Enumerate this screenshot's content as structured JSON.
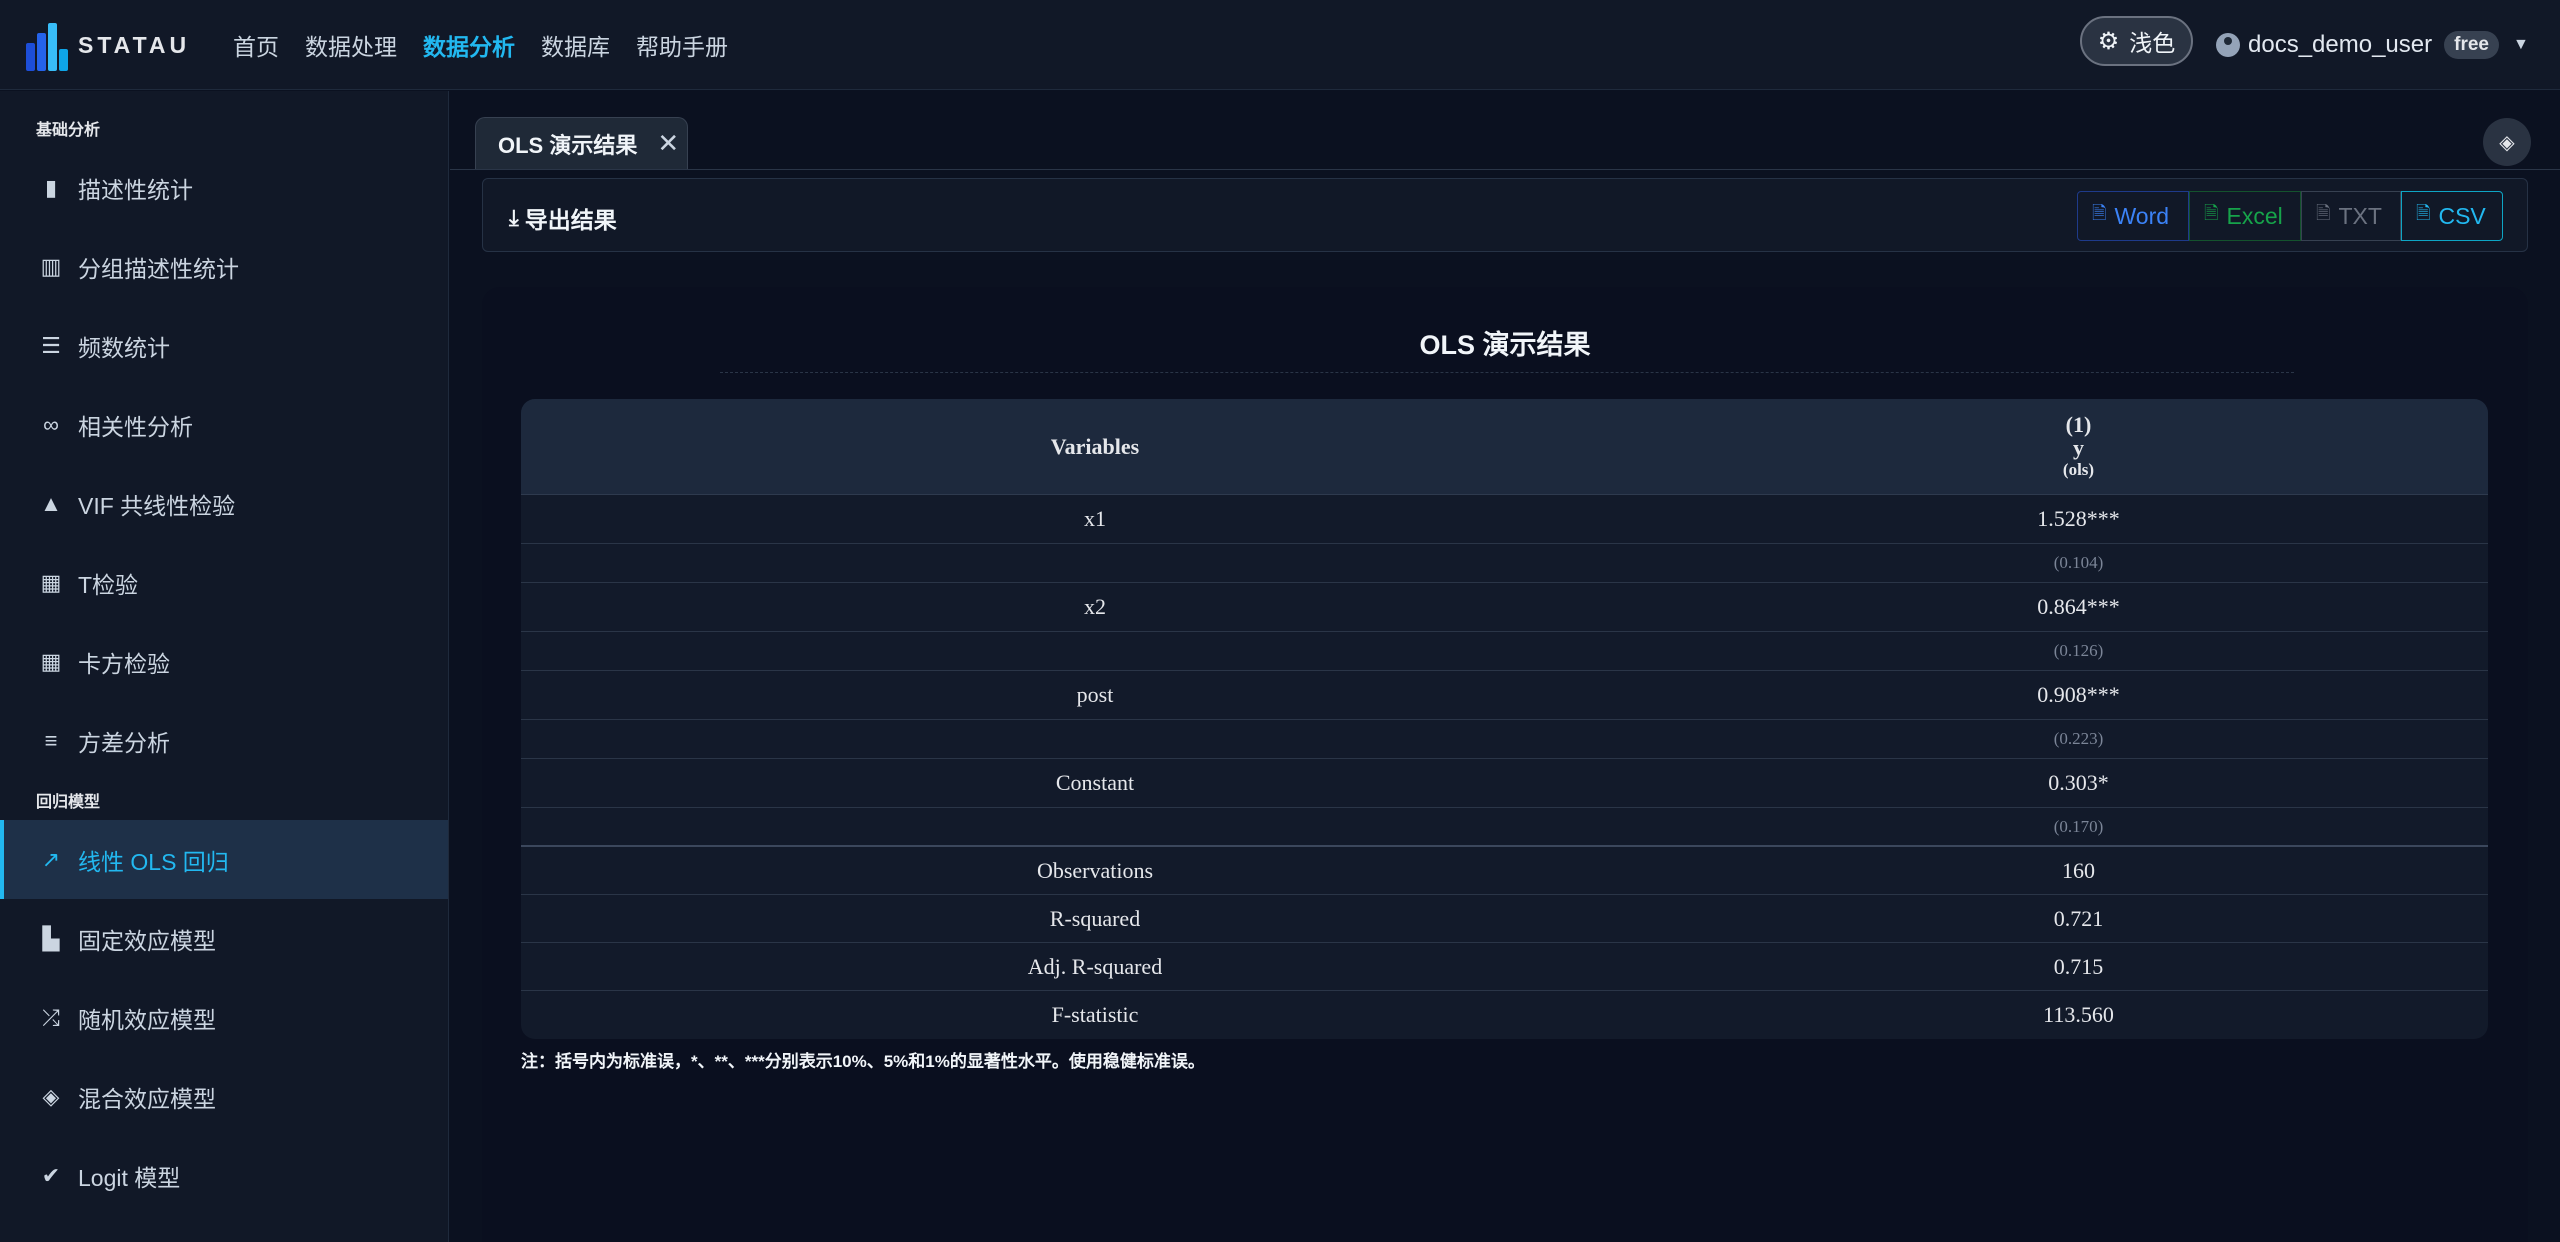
{
  "app": {
    "brand": "STATAU",
    "nav": [
      "首页",
      "数据处理",
      "数据分析",
      "数据库",
      "帮助手册"
    ],
    "active_nav": "数据分析",
    "theme_toggle_label": "浅色",
    "user": {
      "name": "docs_demo_user",
      "plan": "free"
    },
    "accent_color": "#22b8f0"
  },
  "sidebar": {
    "group_basic": "基础分析",
    "basic_items": [
      {
        "label": "描述性统计",
        "icon": "bar-chart-icon"
      },
      {
        "label": "分组描述性统计",
        "icon": "grouped-bar-chart-icon"
      },
      {
        "label": "频数统计",
        "icon": "table-list-icon"
      },
      {
        "label": "相关性分析",
        "icon": "link-icon"
      },
      {
        "label": "VIF 共线性检验",
        "icon": "warning-icon"
      },
      {
        "label": "T检验",
        "icon": "calculator-icon"
      },
      {
        "label": "卡方检验",
        "icon": "grid-icon"
      },
      {
        "label": "方差分析",
        "icon": "bar-chart-horizontal-icon"
      }
    ],
    "group_regression": "回归模型",
    "regression_items": [
      {
        "label": "线性 OLS 回归",
        "icon": "line-chart-icon",
        "active": true
      },
      {
        "label": "固定效应模型",
        "icon": "building-icon"
      },
      {
        "label": "随机效应模型",
        "icon": "shuffle-icon"
      },
      {
        "label": "混合效应模型",
        "icon": "layers-icon"
      },
      {
        "label": "Logit 模型",
        "icon": "check-circle-icon"
      }
    ]
  },
  "main": {
    "tab_label": "OLS 演示结果",
    "export": {
      "title": "导出结果",
      "buttons": [
        "Word",
        "Excel",
        "TXT",
        "CSV"
      ]
    },
    "result_title": "OLS 演示结果",
    "table": {
      "header": {
        "variables": "Variables",
        "model_num": "(1)",
        "dep_var": "y",
        "method": "(ols)"
      },
      "coefficients": [
        {
          "name": "x1",
          "coef": "1.528***",
          "se": "(0.104)"
        },
        {
          "name": "x2",
          "coef": "0.864***",
          "se": "(0.126)"
        },
        {
          "name": "post",
          "coef": "0.908***",
          "se": "(0.223)"
        },
        {
          "name": "Constant",
          "coef": "0.303*",
          "se": "(0.170)"
        }
      ],
      "stats": [
        {
          "name": "Observations",
          "value": "160"
        },
        {
          "name": "R-squared",
          "value": "0.721"
        },
        {
          "name": "Adj. R-squared",
          "value": "0.715"
        },
        {
          "name": "F-statistic",
          "value": "113.560"
        }
      ]
    },
    "note": "注：括号内为标准误，*、**、***分别表示10%、5%和1%的显著性水平。使用稳健标准误。"
  }
}
